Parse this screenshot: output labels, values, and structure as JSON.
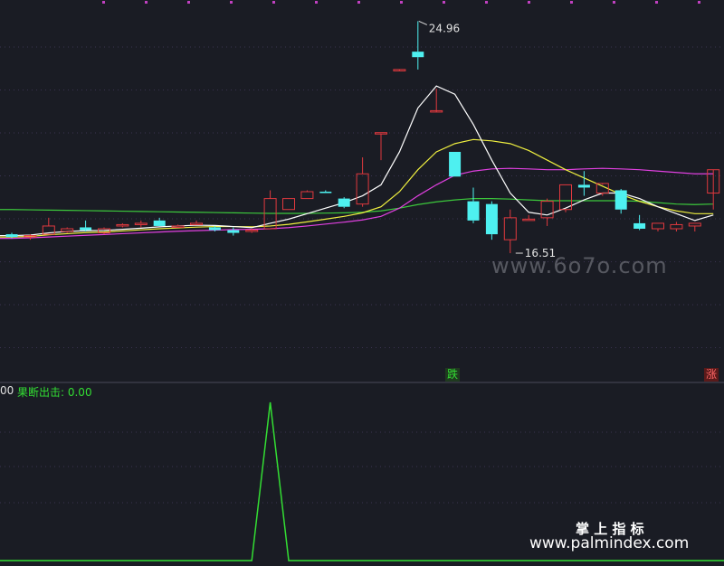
{
  "indicator": {
    "prefix": "00",
    "label": "果断出击: 0.00",
    "color": "#33dd33",
    "signal_bar_index": 14,
    "signal_value": 1
  },
  "tags": {
    "fall": "跌",
    "rise": "涨"
  },
  "watermarks": {
    "mid": "www.6o7o.com",
    "brand_cn": "掌 上 指 标",
    "brand_url": "www.palmindex.com"
  },
  "colors": {
    "background": "#1a1c24",
    "up": "#e0393e",
    "down": "#4ef0f0",
    "ma1": "#ffffff",
    "ma2": "#f0f040",
    "ma3": "#e040e0",
    "ma4": "#3cc83c",
    "grid": "#3a3350",
    "dots": "#c040c0"
  },
  "chart_data": {
    "type": "candlestick",
    "y_range": [
      11.9,
      25.6
    ],
    "annotations": [
      {
        "text": "24.96",
        "bar_index": 22,
        "value": 24.96,
        "kind": "high"
      },
      {
        "text": "16.51",
        "bar_index": 27,
        "value": 16.51,
        "kind": "low"
      }
    ],
    "candles": [
      {
        "o": 17.2,
        "h": 17.25,
        "l": 17.05,
        "c": 17.1
      },
      {
        "o": 17.1,
        "h": 17.2,
        "l": 17.0,
        "c": 17.15
      },
      {
        "o": 17.2,
        "h": 17.8,
        "l": 17.2,
        "c": 17.5
      },
      {
        "o": 17.3,
        "h": 17.45,
        "l": 17.25,
        "c": 17.4
      },
      {
        "o": 17.45,
        "h": 17.7,
        "l": 17.3,
        "c": 17.35
      },
      {
        "o": 17.25,
        "h": 17.45,
        "l": 17.2,
        "c": 17.4
      },
      {
        "o": 17.5,
        "h": 17.6,
        "l": 17.45,
        "c": 17.55
      },
      {
        "o": 17.55,
        "h": 17.7,
        "l": 17.45,
        "c": 17.6
      },
      {
        "o": 17.7,
        "h": 17.8,
        "l": 17.5,
        "c": 17.5
      },
      {
        "o": 17.5,
        "h": 17.55,
        "l": 17.45,
        "c": 17.5
      },
      {
        "o": 17.55,
        "h": 17.7,
        "l": 17.55,
        "c": 17.6
      },
      {
        "o": 17.45,
        "h": 17.5,
        "l": 17.3,
        "c": 17.35
      },
      {
        "o": 17.35,
        "h": 17.45,
        "l": 17.15,
        "c": 17.25
      },
      {
        "o": 17.3,
        "h": 17.4,
        "l": 17.25,
        "c": 17.35
      },
      {
        "o": 17.4,
        "h": 18.8,
        "l": 17.4,
        "c": 18.5
      },
      {
        "o": 18.1,
        "h": 18.5,
        "l": 18.1,
        "c": 18.5
      },
      {
        "o": 18.5,
        "h": 18.8,
        "l": 18.5,
        "c": 18.75
      },
      {
        "o": 18.75,
        "h": 18.8,
        "l": 18.7,
        "c": 18.7
      },
      {
        "o": 18.5,
        "h": 18.55,
        "l": 18.15,
        "c": 18.2
      },
      {
        "o": 18.3,
        "h": 20.0,
        "l": 18.2,
        "c": 19.4
      },
      {
        "o": 20.9,
        "h": 20.9,
        "l": 19.9,
        "c": 20.9
      },
      {
        "o": 23.2,
        "h": 23.2,
        "l": 23.2,
        "c": 23.2
      },
      {
        "o": 23.85,
        "h": 24.96,
        "l": 23.2,
        "c": 23.65
      },
      {
        "o": 21.7,
        "h": 22.5,
        "l": 21.7,
        "c": 21.7
      },
      {
        "o": 20.2,
        "h": 20.2,
        "l": 19.3,
        "c": 19.3
      },
      {
        "o": 18.4,
        "h": 18.9,
        "l": 17.6,
        "c": 17.7
      },
      {
        "o": 18.3,
        "h": 18.4,
        "l": 17.0,
        "c": 17.2
      },
      {
        "o": 17.0,
        "h": 18.1,
        "l": 16.51,
        "c": 17.8
      },
      {
        "o": 17.75,
        "h": 17.9,
        "l": 17.7,
        "c": 17.75
      },
      {
        "o": 17.8,
        "h": 18.5,
        "l": 17.5,
        "c": 18.4
      },
      {
        "o": 18.1,
        "h": 19.0,
        "l": 18.0,
        "c": 19.0
      },
      {
        "o": 19.0,
        "h": 19.5,
        "l": 18.6,
        "c": 18.9
      },
      {
        "o": 18.7,
        "h": 19.0,
        "l": 18.6,
        "c": 19.05
      },
      {
        "o": 18.8,
        "h": 18.85,
        "l": 17.95,
        "c": 18.1
      },
      {
        "o": 17.6,
        "h": 17.9,
        "l": 17.35,
        "c": 17.4
      },
      {
        "o": 17.4,
        "h": 17.6,
        "l": 17.3,
        "c": 17.6
      },
      {
        "o": 17.4,
        "h": 17.65,
        "l": 17.3,
        "c": 17.55
      },
      {
        "o": 17.5,
        "h": 17.6,
        "l": 17.3,
        "c": 17.6
      },
      {
        "o": 18.7,
        "h": 18.7,
        "l": 18.1,
        "c": 19.55
      }
    ],
    "ma1": [
      17.15,
      17.17,
      17.25,
      17.3,
      17.33,
      17.34,
      17.38,
      17.42,
      17.47,
      17.5,
      17.53,
      17.52,
      17.48,
      17.44,
      17.6,
      17.75,
      17.95,
      18.15,
      18.35,
      18.6,
      19.0,
      20.2,
      21.8,
      22.6,
      22.3,
      21.2,
      19.9,
      18.7,
      18.0,
      17.9,
      18.15,
      18.45,
      18.7,
      18.7,
      18.5,
      18.2,
      17.95,
      17.7,
      17.9
    ],
    "ma2": [
      17.1,
      17.12,
      17.18,
      17.22,
      17.26,
      17.28,
      17.32,
      17.36,
      17.4,
      17.43,
      17.46,
      17.48,
      17.48,
      17.47,
      17.5,
      17.56,
      17.65,
      17.75,
      17.85,
      17.98,
      18.2,
      18.75,
      19.55,
      20.2,
      20.5,
      20.65,
      20.6,
      20.5,
      20.25,
      19.9,
      19.55,
      19.25,
      18.95,
      18.65,
      18.4,
      18.2,
      18.05,
      17.95,
      17.95
    ],
    "ma3": [
      17.05,
      17.07,
      17.1,
      17.13,
      17.16,
      17.19,
      17.22,
      17.25,
      17.28,
      17.31,
      17.33,
      17.35,
      17.37,
      17.38,
      17.4,
      17.44,
      17.5,
      17.57,
      17.64,
      17.72,
      17.85,
      18.15,
      18.6,
      19.0,
      19.35,
      19.5,
      19.58,
      19.6,
      19.58,
      19.55,
      19.55,
      19.58,
      19.6,
      19.58,
      19.55,
      19.5,
      19.45,
      19.4,
      19.4
    ],
    "ma4": [
      18.1,
      18.09,
      18.08,
      18.07,
      18.06,
      18.05,
      18.04,
      18.03,
      18.02,
      18.01,
      18.0,
      17.99,
      17.98,
      17.97,
      17.96,
      17.96,
      17.96,
      17.97,
      17.98,
      18.0,
      18.05,
      18.15,
      18.28,
      18.38,
      18.45,
      18.5,
      18.5,
      18.48,
      18.45,
      18.42,
      18.42,
      18.42,
      18.42,
      18.42,
      18.4,
      18.35,
      18.3,
      18.28,
      18.3
    ]
  }
}
